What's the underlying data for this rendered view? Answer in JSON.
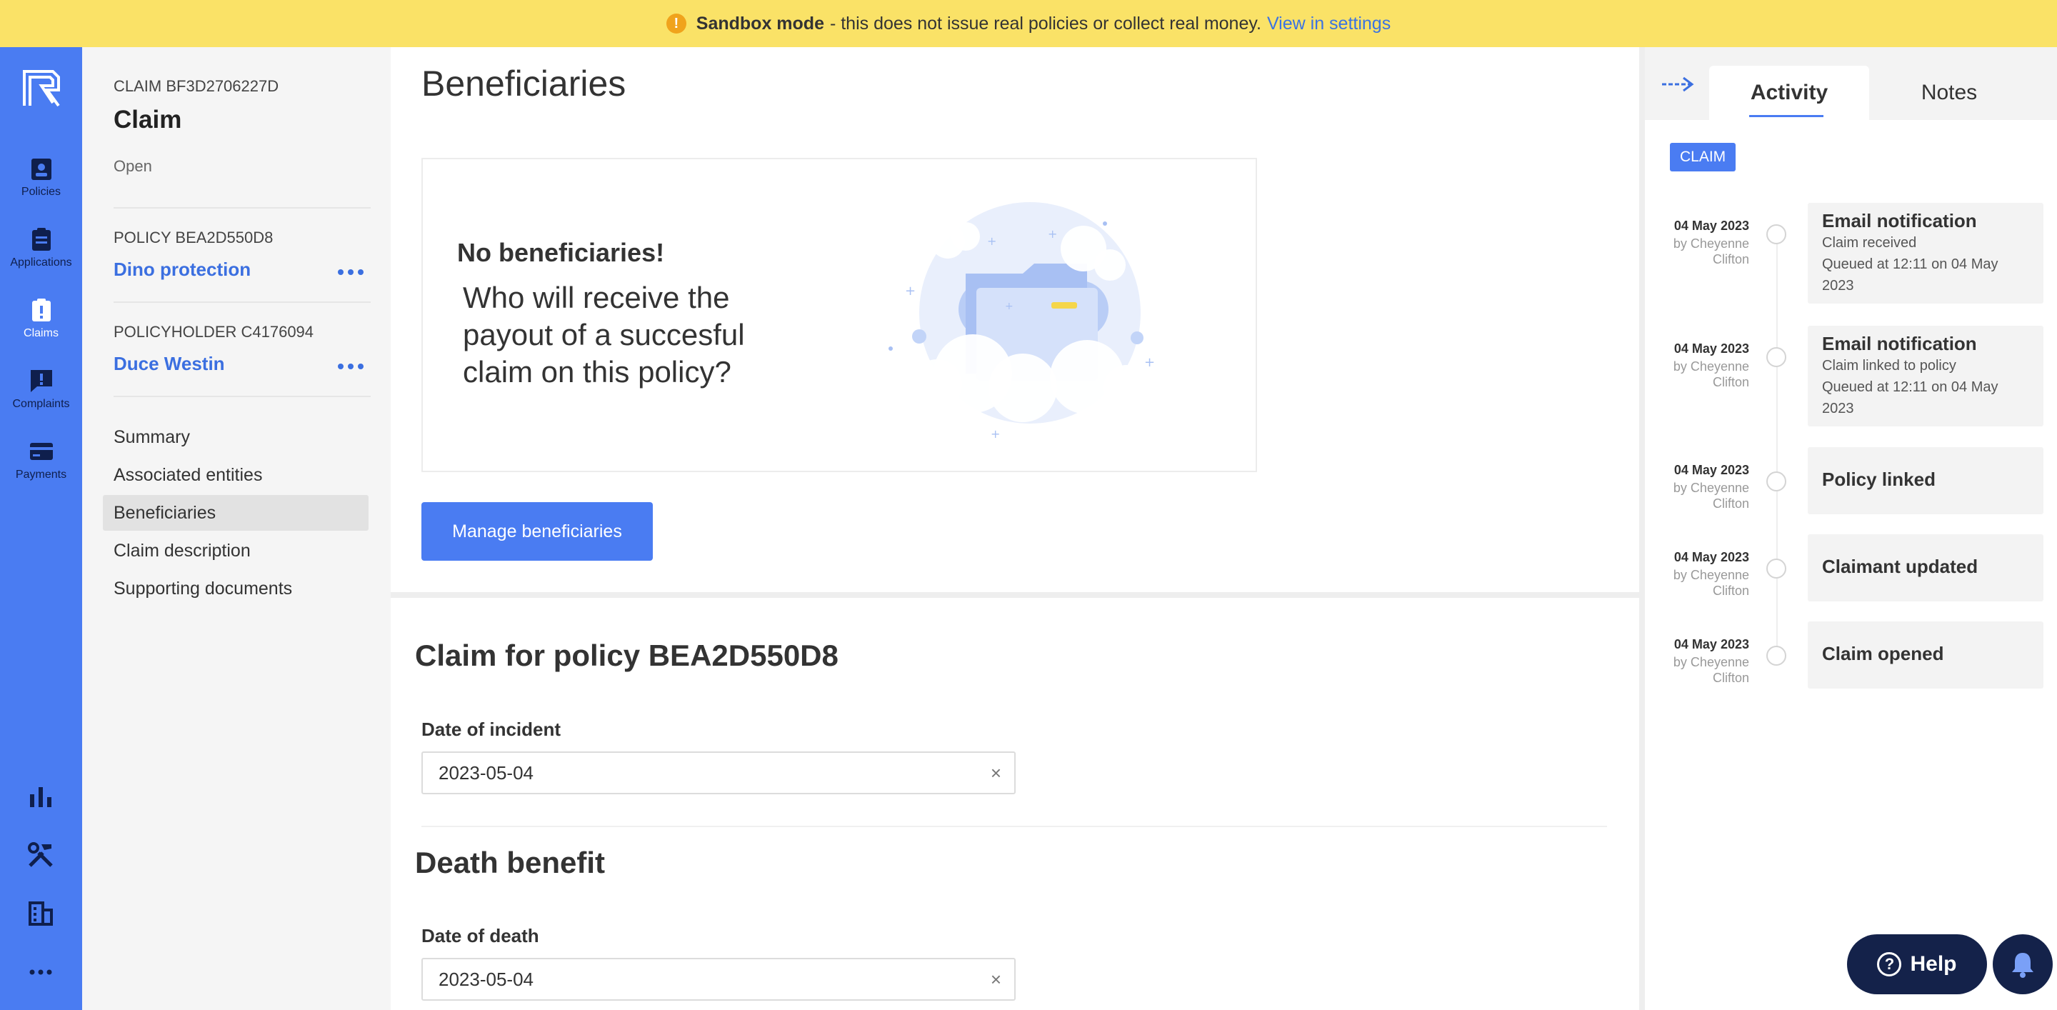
{
  "banner": {
    "bold": "Sandbox mode",
    "text": "- this does not issue real policies or collect real money.",
    "link": "View in settings",
    "icon": "warning-icon"
  },
  "rail": {
    "items": [
      {
        "label": "Policies",
        "icon": "policy-icon"
      },
      {
        "label": "Applications",
        "icon": "clipboard-icon"
      },
      {
        "label": "Claims",
        "icon": "claims-icon"
      },
      {
        "label": "Complaints",
        "icon": "complaint-icon"
      },
      {
        "label": "Payments",
        "icon": "card-icon"
      }
    ],
    "tools": [
      "chart-icon",
      "tools-icon",
      "building-icon",
      "more-icon"
    ]
  },
  "sidebar": {
    "claim_label": "CLAIM BF3D2706227D",
    "claim_title": "Claim",
    "claim_status": "Open",
    "policy_label": "POLICY BEA2D550D8",
    "policy_name": "Dino protection",
    "holder_label": "POLICYHOLDER C4176094",
    "holder_name": "Duce Westin",
    "menu": [
      "Summary",
      "Associated entities",
      "Beneficiaries",
      "Claim description",
      "Supporting documents"
    ],
    "active_menu": "Beneficiaries"
  },
  "main": {
    "title": "Beneficiaries",
    "empty_title": "No beneficiaries!",
    "empty_question": "Who will receive the payout of a succesful claim on this policy?",
    "manage_button": "Manage beneficiaries",
    "section1_title": "Claim for policy BEA2D550D8",
    "incident_label": "Date of incident",
    "incident_value": "2023-05-04",
    "section2_title": "Death benefit",
    "death_label": "Date of death",
    "death_value": "2023-05-04",
    "clear_glyph": "×"
  },
  "panel": {
    "tabs": [
      "Activity",
      "Notes"
    ],
    "active_tab": "Activity",
    "tag": "CLAIM",
    "events": [
      {
        "date": "04 May 2023",
        "by1": "by Cheyenne",
        "by2": "Clifton",
        "title": "Email notification",
        "line1": "Claim received",
        "line2": "Queued at 12:11 on 04 May",
        "line3": "2023"
      },
      {
        "date": "04 May 2023",
        "by1": "by Cheyenne",
        "by2": "Clifton",
        "title": "Email notification",
        "line1": "Claim linked to policy",
        "line2": "Queued at 12:11 on 04 May",
        "line3": "2023"
      },
      {
        "date": "04 May 2023",
        "by1": "by Cheyenne",
        "by2": "Clifton",
        "title": "Policy linked"
      },
      {
        "date": "04 May 2023",
        "by1": "by Cheyenne",
        "by2": "Clifton",
        "title": "Claimant updated"
      },
      {
        "date": "04 May 2023",
        "by1": "by Cheyenne",
        "by2": "Clifton",
        "title": "Claim opened"
      }
    ]
  },
  "help": {
    "label": "Help"
  },
  "colors": {
    "accent": "#4a7cf2",
    "banner": "#fae267",
    "navy": "#14224a"
  }
}
